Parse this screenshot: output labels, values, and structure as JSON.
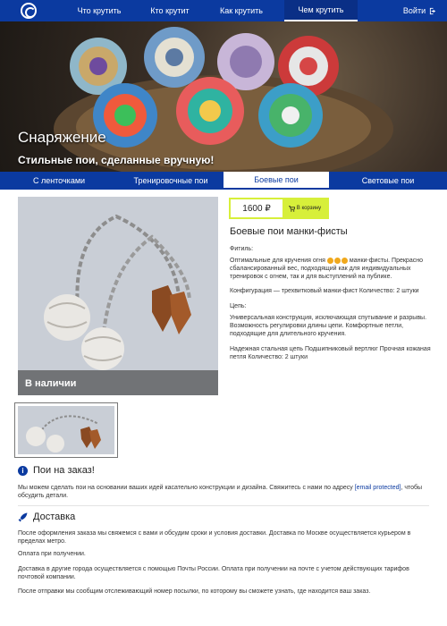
{
  "nav": {
    "items": [
      "Что крутить",
      "Кто крутит",
      "Как крутить",
      "Чем крутить"
    ],
    "login": "Войти"
  },
  "hero": {
    "title": "Снаряжение",
    "subtitle": "Стильные пои, сделанные вручную!"
  },
  "category_tabs": [
    "С ленточками",
    "Тренировочные пои",
    "Боевые пои",
    "Световые пои"
  ],
  "product": {
    "availability": "В наличии",
    "price": "1600 ₽",
    "cart_label": "В корзину",
    "title": "Боевые пои манки-фисты",
    "wick_label": "Фитиль:",
    "wick_text_before": "Оптимальные для кручения огня",
    "wick_text_after": "манки-фисты. Прекрасно сбалансированный вес, подходящий как для индивидуальных тренировок с огнем, так и для выступлений на публике.",
    "config_text": "Конфигурация — трехвитковый манки-фист Количество: 2 штуки",
    "chain_label": "Цепь:",
    "chain_text1": "Универсальная конструкция, исключающая спутывание и разрывы. Возможность регулировки длины цепи. Комфортные петли, подходящие для длительного кручения.",
    "chain_text2": "Надежная стальная цепь Подшипниковый вертлюг Прочная кожаная петля Количество: 2 штуки"
  },
  "custom_order": {
    "title": "Пои на заказ!",
    "text_before": "Мы можем сделать пои на основании ваших идей касательно конструкции и дизайна. Свяжитесь с нами по адресу",
    "link": "[email protected]",
    "text_after": ", чтобы обсудить детали."
  },
  "delivery": {
    "title": "Доставка",
    "p1": "После оформления заказа мы свяжемся с вами и обсудим сроки и условия доставки. Доставка по Москве осуществляется курьером в пределах метро.",
    "p2": "Оплата при получении.",
    "p3": "Доставка в другие города осуществляется с помощью Почты России. Оплата при получении на почте с учетом действующих тарифов почтовой компании.",
    "p4": "После отправки мы сообщим отслеживающий номер посылки, по которому вы сможете узнать, где находится ваш заказ."
  },
  "colors": {
    "brand": "#0b3aa0",
    "accent": "#d7ef3a"
  }
}
